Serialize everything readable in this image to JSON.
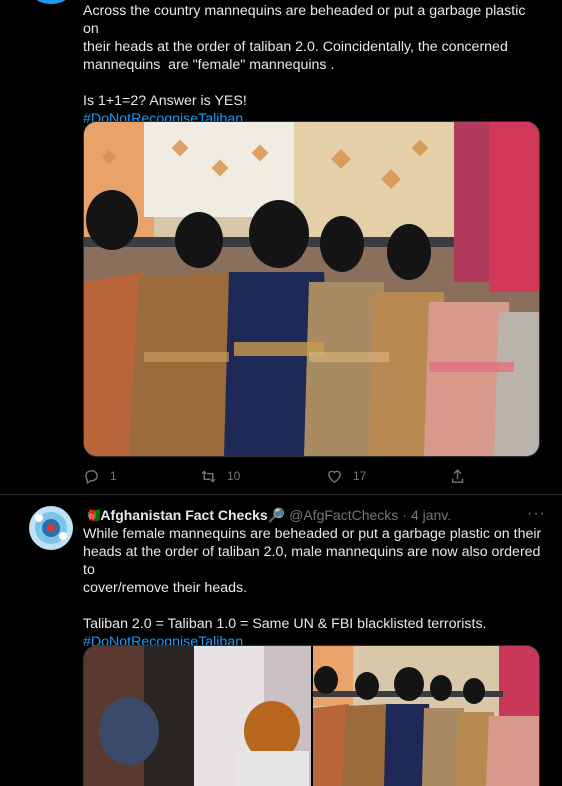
{
  "tweet1": {
    "text_lines": [
      "Across the country mannequins are beheaded or put a garbage plastic on",
      "their heads at the order of taliban 2.0. Coincidentally, the concerned",
      "mannequins  are \"female\" mannequins ."
    ],
    "line2": "Is 1+1=2? Answer is YES!",
    "hashtag": "#DoNotRecogniseTaliban",
    "media_desc_icon": "mannequins-photo",
    "actions": {
      "reply_count": "1",
      "retweet_count": "10",
      "like_count": "17"
    }
  },
  "tweet2": {
    "author_name": "🇦🇫Afghanistan Fact Checks🔎",
    "author_handle": "@AfgFactChecks",
    "separator": "·",
    "date": "4 janv.",
    "more": "···",
    "text_lines": [
      "While female mannequins are beheaded or put a garbage plastic on their",
      "heads at the order of taliban 2.0, male mannequins are now also ordered to",
      "cover/remove their heads."
    ],
    "line2": "Taliban 2.0 = Taliban 1.0 = Same UN & FBI blacklisted terrorists.",
    "hashtag": "#DoNotRecogniseTaliban"
  },
  "colors": {
    "accent": "#1d9bf0",
    "muted": "#71767b",
    "bg": "#000000"
  }
}
